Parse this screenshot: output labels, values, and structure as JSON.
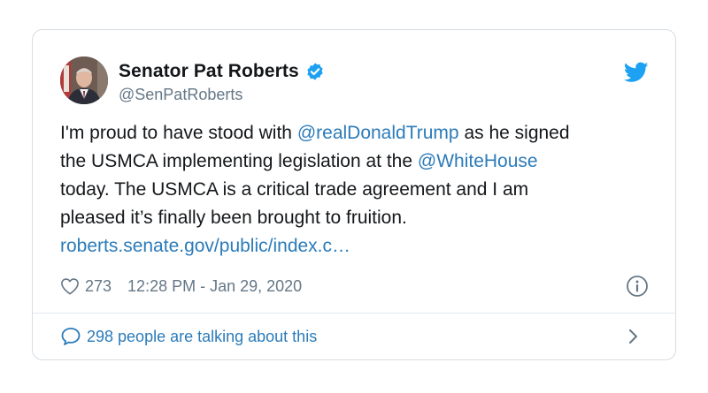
{
  "tweet": {
    "display_name": "Senator Pat Roberts",
    "handle": "@SenPatRoberts",
    "verified": true,
    "text": {
      "line1_pre": "I'm proud to have stood with ",
      "mention1": "@realDonaldTrump",
      "line1_post": " as he signed",
      "line2_pre": "the USMCA implementing legislation at the ",
      "mention2": "@WhiteHouse",
      "line3": "today. The USMCA is a critical trade agreement and I am",
      "line4": "pleased it’s finally been brought to fruition.",
      "link": "roberts.senate.gov/public/index.c…"
    },
    "likes": "273",
    "timestamp": "12:28 PM - Jan 29, 2020",
    "talking": "298 people are talking about this"
  },
  "icons": {
    "verified": "verified-badge-icon",
    "brand": "twitter-bird-icon",
    "like": "heart-icon",
    "info": "info-icon",
    "reply": "speech-bubble-icon",
    "more": "chevron-right-icon"
  },
  "colors": {
    "link": "#2b7bb9",
    "muted": "#657786",
    "text": "#14171a",
    "brand": "#1da1f2",
    "border": "#d7dde2"
  }
}
